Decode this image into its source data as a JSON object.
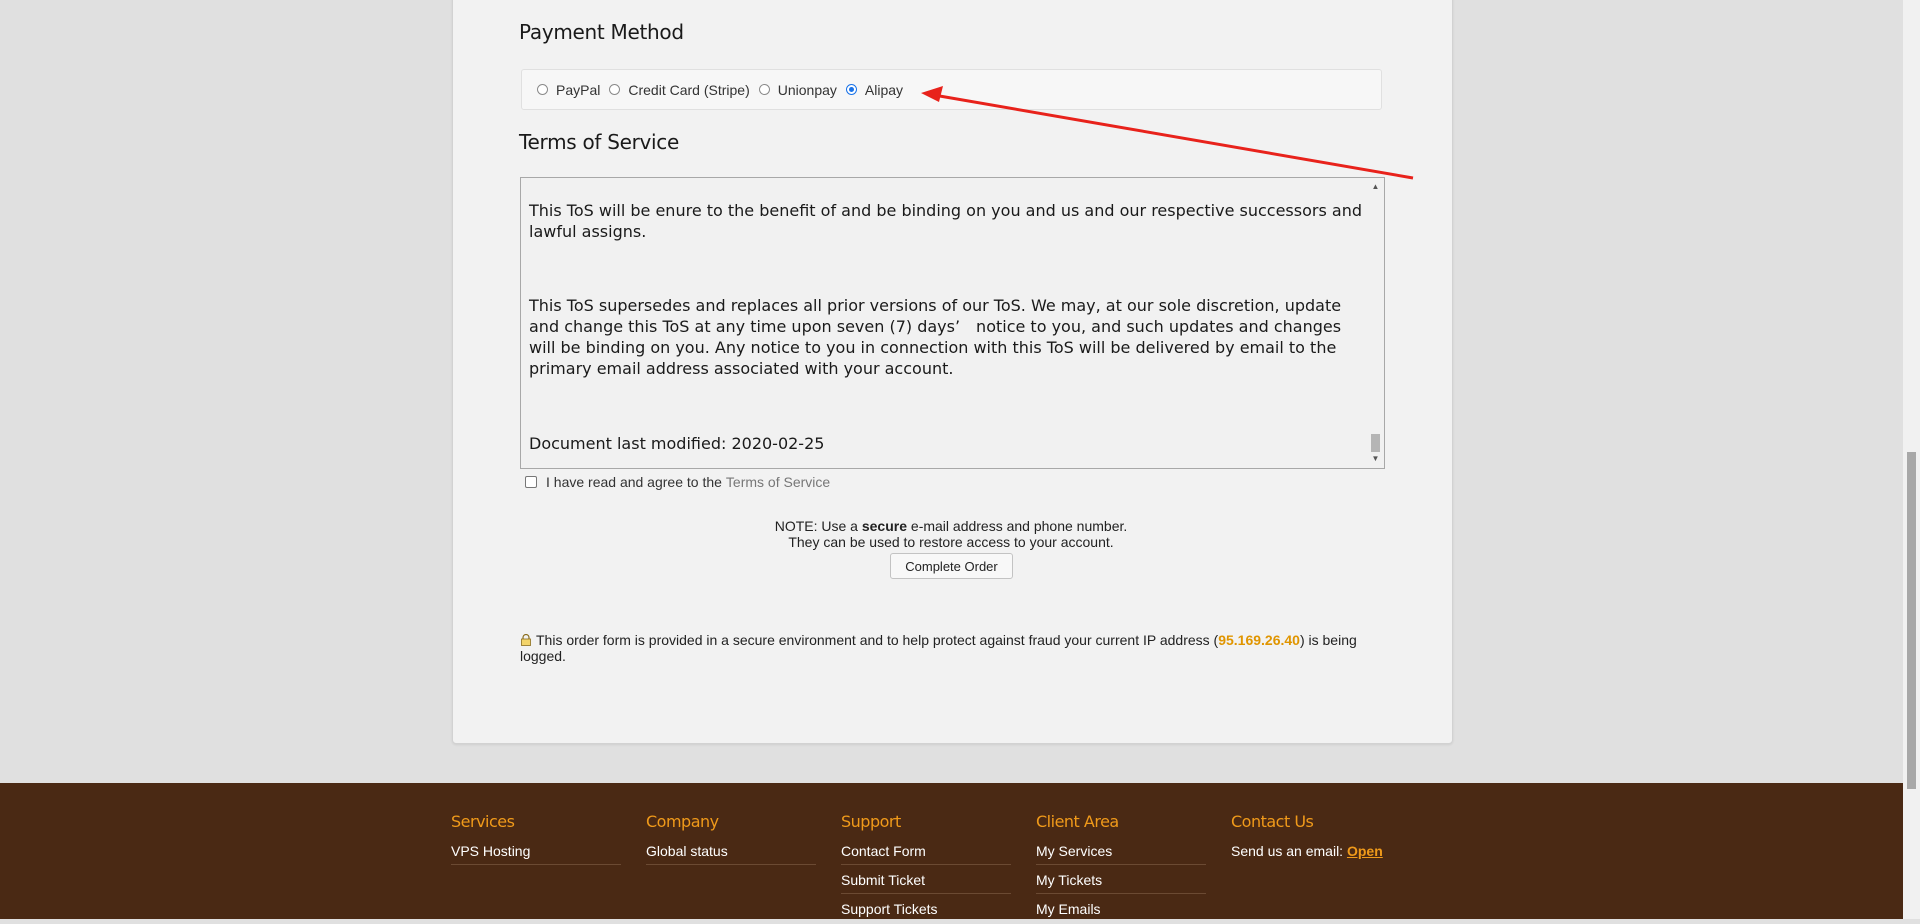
{
  "payment": {
    "title": "Payment Method",
    "options": [
      {
        "label": "PayPal",
        "checked": false
      },
      {
        "label": "Credit Card (Stripe)",
        "checked": false
      },
      {
        "label": "Unionpay",
        "checked": false
      },
      {
        "label": "Alipay",
        "checked": true
      }
    ]
  },
  "tos": {
    "title": "Terms of Service",
    "paragraphs": [
      "This ToS will be enure to the benefit of and be binding on you and us and our respective successors and lawful assigns.",
      "This ToS supersedes and replaces all prior versions of our ToS. We may, at our sole discretion, update and change this ToS at any time upon seven (7) days’　notice to you, and such updates and changes will be binding on you. Any notice to you in connection with this ToS will be delivered by email to the primary email address associated with your account.",
      "Document last modified: 2020-02-25"
    ],
    "agree_prefix": "I have read and agree to the",
    "agree_link": "Terms of Service"
  },
  "note": {
    "line1_prefix": "NOTE: Use a",
    "line1_bold": "secure",
    "line1_suffix": "e-mail address and phone number.",
    "line2": "They can be used to restore access to your account."
  },
  "complete_button": "Complete Order",
  "secure_notice": {
    "prefix": "This order form is provided in a secure environment and to help protect against fraud your current IP address (",
    "ip": "95.169.26.40",
    "suffix": ") is being logged."
  },
  "footer": {
    "services": {
      "title": "Services",
      "links": [
        "VPS Hosting"
      ]
    },
    "company": {
      "title": "Company",
      "links": [
        "Global status"
      ]
    },
    "support": {
      "title": "Support",
      "links": [
        "Contact Form",
        "Submit Ticket",
        "Support Tickets"
      ]
    },
    "client_area": {
      "title": "Client Area",
      "links": [
        "My Services",
        "My Tickets",
        "My Emails"
      ]
    },
    "contact": {
      "title": "Contact Us",
      "text": "Send us an email:",
      "link": "Open"
    }
  },
  "colors": {
    "accent_orange": "#f09a1a",
    "footer_bg": "#4a2914",
    "arrow_red": "#e8221b",
    "radio_blue": "#1a73e8"
  },
  "icons": [
    "lock-icon",
    "scroll-up-icon",
    "scroll-down-icon",
    "annotation-arrow-icon"
  ]
}
